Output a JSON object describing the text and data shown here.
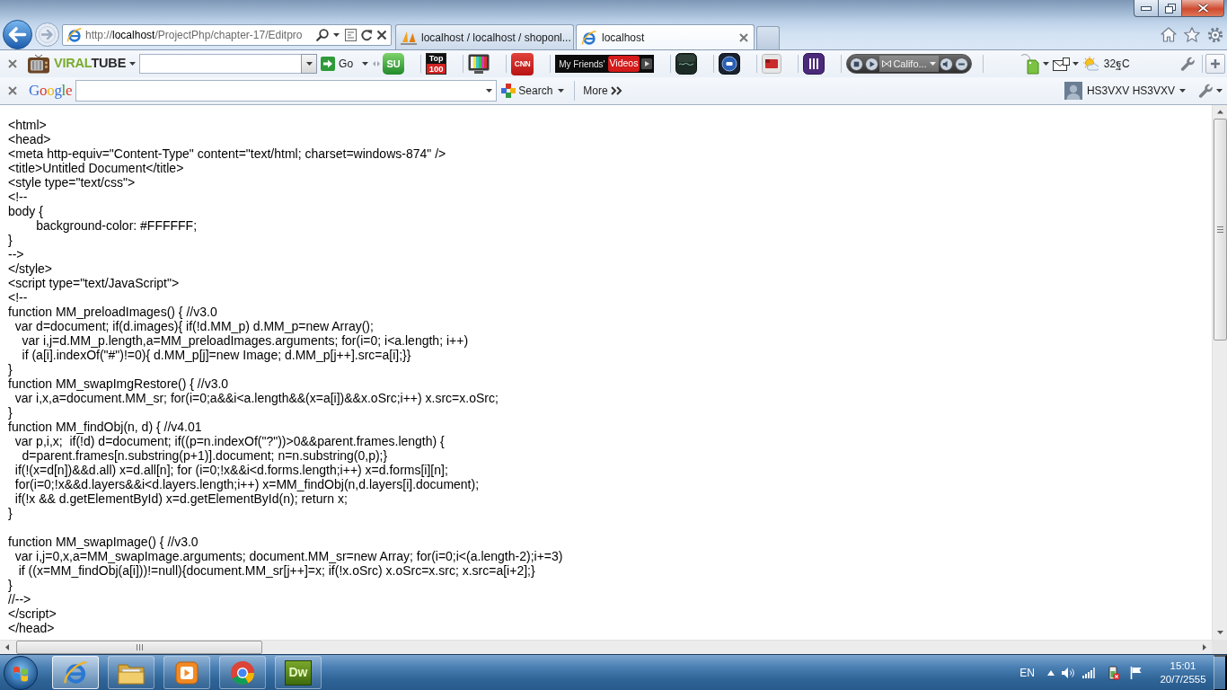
{
  "browser": {
    "address": {
      "scheme": "http://",
      "host": "localhost",
      "path": "/ProjectPhp/chapter-17/Editpro"
    },
    "tabs": [
      {
        "title": "localhost / localhost / shoponl...",
        "kind": "admin",
        "selected": false
      },
      {
        "title": "localhost",
        "kind": "page",
        "selected": true
      }
    ]
  },
  "video_toolbar": {
    "brand": {
      "lead": "VIRAL",
      "tail": "TUBE"
    },
    "go_label": "Go",
    "apps": [
      {
        "kind": "letter-tile",
        "lines": [
          "SU"
        ]
      },
      {
        "kind": "chart-badge",
        "lines": [
          "Top",
          "100"
        ]
      },
      {
        "kind": "tv-bars"
      },
      {
        "kind": "news-tile",
        "lines": [
          "CNN"
        ]
      },
      {
        "kind": "video-bar",
        "lines": [
          "My Friends'",
          "Videos"
        ]
      },
      {
        "kind": "blank-tile"
      },
      {
        "kind": "round-tile"
      },
      {
        "kind": "screen-tile"
      },
      {
        "kind": "striped-tile"
      }
    ],
    "player": {
      "track": "Califo..."
    },
    "weather": {
      "reading": "32ฐC"
    }
  },
  "search_toolbar": {
    "logo": "Google",
    "search_label": "Search",
    "more_label": "More",
    "user": "HS3VXV HS3VXV"
  },
  "page": {
    "sections": [
      {
        "lines": [
          "<html>",
          "<head>",
          "<meta http-equiv=\"Content-Type\" content=\"text/html; charset=windows-874\" />",
          "<title>Untitled Document</title>",
          "<style type=\"text/css\">",
          "<!--",
          "body {",
          "\tbackground-color: #FFFFFF;",
          "}",
          "-->",
          "</style>",
          "<script type=\"text/JavaScript\">",
          "<!--",
          "function MM_preloadImages() { //v3.0",
          "  var d=document; if(d.images){ if(!d.MM_p) d.MM_p=new Array();",
          "    var i,j=d.MM_p.length,a=MM_preloadImages.arguments; for(i=0; i<a.length; i++)",
          "    if (a[i].indexOf(\"#\")!=0){ d.MM_p[j]=new Image; d.MM_p[j++].src=a[i];}}",
          "}",
          "function MM_swapImgRestore() { //v3.0",
          "  var i,x,a=document.MM_sr; for(i=0;a&&i<a.length&&(x=a[i])&&x.oSrc;i++) x.src=x.oSrc;",
          "}",
          "function MM_findObj(n, d) { //v4.01",
          "  var p,i,x;  if(!d) d=document; if((p=n.indexOf(\"?\"))>0&&parent.frames.length) {",
          "    d=parent.frames[n.substring(p+1)].document; n=n.substring(0,p);}",
          "  if(!(x=d[n])&&d.all) x=d.all[n]; for (i=0;!x&&i<d.forms.length;i++) x=d.forms[i][n];",
          "  for(i=0;!x&&d.layers&&i<d.layers.length;i++) x=MM_findObj(n,d.layers[i].document);",
          "  if(!x && d.getElementById) x=d.getElementById(n); return x;",
          "}"
        ]
      },
      {
        "lines": [
          "function MM_swapImage() { //v3.0",
          "  var i,j=0,x,a=MM_swapImage.arguments; document.MM_sr=new Array; for(i=0;i<(a.length-2);i+=3)",
          "   if ((x=MM_findObj(a[i]))!=null){document.MM_sr[j++]=x; if(!x.oSrc) x.oSrc=x.src; x.src=a[i+2];}",
          "}",
          "//-->",
          "</script>",
          "</head>"
        ]
      }
    ]
  },
  "taskbar": {
    "apps": [
      {
        "kind": "ie",
        "active": true
      },
      {
        "kind": "folder",
        "active": false
      },
      {
        "kind": "player",
        "active": false
      },
      {
        "kind": "chrome",
        "active": false
      },
      {
        "kind": "dw",
        "label": "Dw",
        "active": false
      }
    ],
    "language": "EN",
    "time": "15:01",
    "date": "20/7/2555"
  }
}
